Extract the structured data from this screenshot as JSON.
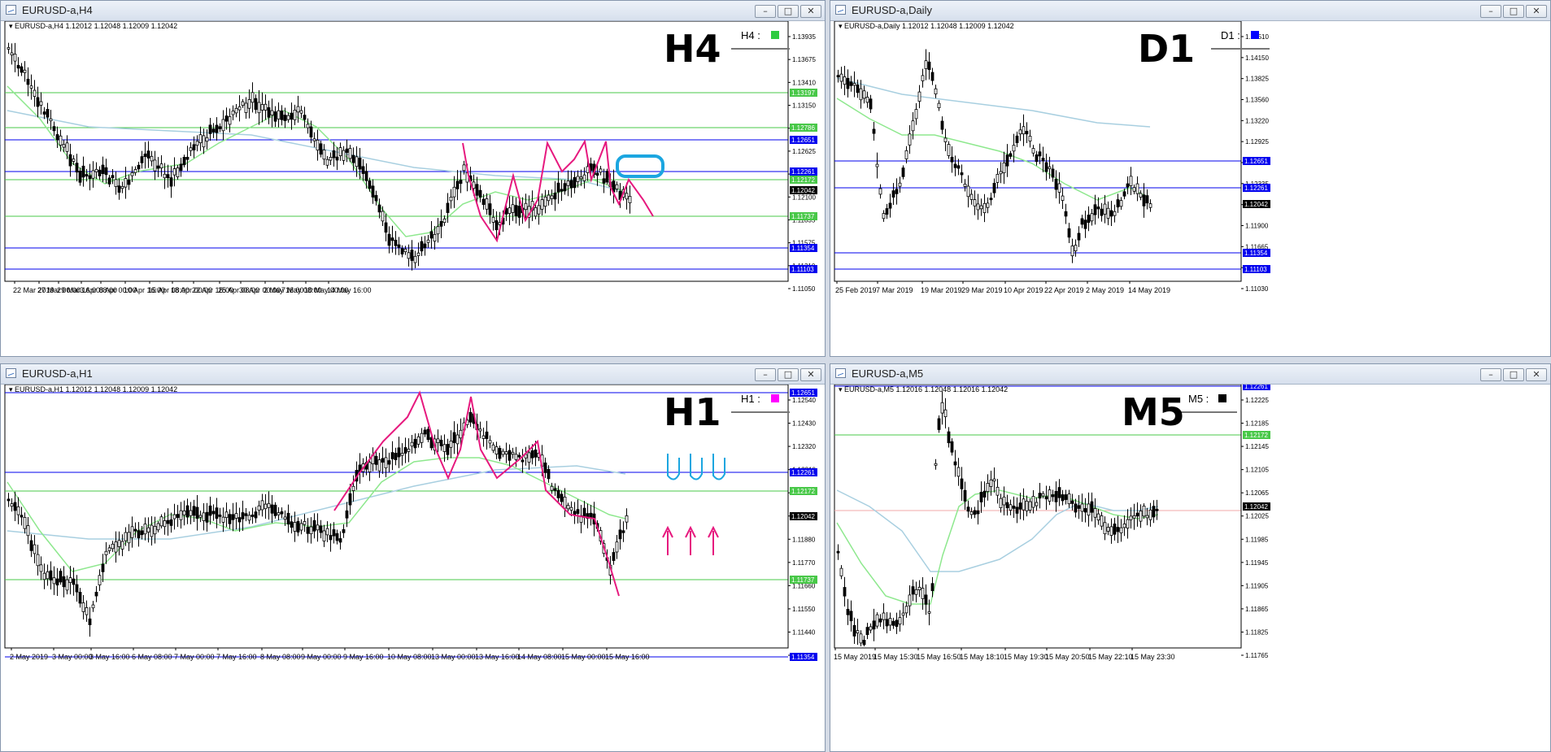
{
  "colors": {
    "green_level": "#48c848",
    "blue_level": "#0000ee",
    "ma_fast": "#8ee88e",
    "ma_slow": "#a8cfe0",
    "ma_red": "#f2a8a8",
    "annotation_pink": "#e6197e",
    "annotation_cyan": "#1ba6e0",
    "bull": "#ffffff",
    "bear": "#000000"
  },
  "windows": [
    {
      "id": "h4",
      "title": "EURUSD-a,H4",
      "buttons": [
        "minimize",
        "restore",
        "close"
      ],
      "header": "EURUSD-a,H4  1.12012 1.12048 1.12009 1.12042",
      "label": "H4 :",
      "label_color": "#2ecc40",
      "handwritten": "H4",
      "price_labels": [
        "1.13935",
        "1.13675",
        "1.13410",
        "1.13150",
        "1.12885",
        "1.12625",
        "1.12360",
        "1.12100",
        "1.11835",
        "1.11575",
        "1.11310",
        "1.11050"
      ],
      "level_tags": [
        {
          "text": "1.13197",
          "color": "green"
        },
        {
          "text": "1.12786",
          "color": "green"
        },
        {
          "text": "1.12651",
          "color": "blue"
        },
        {
          "text": "1.12261",
          "color": "blue"
        },
        {
          "text": "1.12172",
          "color": "green"
        },
        {
          "text": "1.12042",
          "color": "black"
        },
        {
          "text": "1.11737",
          "color": "green"
        },
        {
          "text": "1.11354",
          "color": "blue"
        },
        {
          "text": "1.11103",
          "color": "blue"
        }
      ],
      "time_labels": [
        "22 Mar 2019",
        "27 Mar 00:00",
        "29 Mar 16:00",
        "3 Apr 08:00",
        "8 Apr 00:00",
        "10 Apr 16:00",
        "15 Apr 08:00",
        "18 Apr 00:00",
        "22 Apr 16:00",
        "25 Apr 08:00",
        "30 Apr 00:00",
        "2 May 16:00",
        "7 May 08:00",
        "10 May 00:00",
        "14 May 16:00"
      ]
    },
    {
      "id": "d1",
      "title": "EURUSD-a,Daily",
      "buttons": [
        "minimize",
        "restore",
        "close"
      ],
      "header": "EURUSD-a,Daily  1.12012 1.12048 1.12009 1.12042",
      "label": "D1 :",
      "label_color": "#0000ff",
      "handwritten": "D1",
      "price_labels": [
        "1.14510",
        "1.14150",
        "1.13825",
        "1.13560",
        "1.13220",
        "1.12925",
        "1.12630",
        "1.12335",
        "1.12040",
        "1.11900",
        "1.11665",
        "1.11310",
        "1.11030"
      ],
      "level_tags": [
        {
          "text": "1.12651",
          "color": "blue"
        },
        {
          "text": "1.12261",
          "color": "blue"
        },
        {
          "text": "1.12042",
          "color": "black"
        },
        {
          "text": "1.11354",
          "color": "blue"
        },
        {
          "text": "1.11103",
          "color": "blue"
        }
      ],
      "time_labels": [
        "25 Feb 2019",
        "7 Mar 2019",
        "19 Mar 2019",
        "29 Mar 2019",
        "10 Apr 2019",
        "22 Apr 2019",
        "2 May 2019",
        "14 May 2019"
      ]
    },
    {
      "id": "h1",
      "title": "EURUSD-a,H1",
      "buttons": [
        "minimize",
        "restore",
        "close"
      ],
      "header": "EURUSD-a,H1  1.12012 1.12048 1.12009 1.12042",
      "label": "H1 :",
      "label_color": "#ff00ff",
      "handwritten": "H1",
      "price_labels": [
        "1.12540",
        "1.12430",
        "1.12320",
        "1.12210",
        "1.12100",
        "1.11990",
        "1.11880",
        "1.11770",
        "1.11660",
        "1.11550",
        "1.11440",
        "1.11330"
      ],
      "level_tags": [
        {
          "text": "1.12651",
          "color": "blue"
        },
        {
          "text": "1.12261",
          "color": "blue"
        },
        {
          "text": "1.12172",
          "color": "green"
        },
        {
          "text": "1.12042",
          "color": "black"
        },
        {
          "text": "1.11737",
          "color": "green"
        },
        {
          "text": "1.11354",
          "color": "blue"
        }
      ],
      "time_labels": [
        "2 May 2019",
        "3 May 00:00",
        "3 May 16:00",
        "6 May 08:00",
        "7 May 00:00",
        "7 May 16:00",
        "8 May 08:00",
        "9 May 00:00",
        "9 May 16:00",
        "10 May 08:00",
        "13 May 00:00",
        "13 May 16:00",
        "14 May 08:00",
        "15 May 00:00",
        "15 May 16:00"
      ]
    },
    {
      "id": "m5",
      "title": "EURUSD-a,M5",
      "buttons": [
        "minimize",
        "restore",
        "close"
      ],
      "header": "EURUSD-a,M5  1.12016 1.12048 1.12016 1.12042",
      "label": "M5 :",
      "label_color": "#000000",
      "handwritten": "M5",
      "price_labels": [
        "1.12225",
        "1.12185",
        "1.12145",
        "1.12105",
        "1.12065",
        "1.12025",
        "1.11985",
        "1.11945",
        "1.11905",
        "1.11865",
        "1.11825",
        "1.11765"
      ],
      "level_tags": [
        {
          "text": "1.12261",
          "color": "blue"
        },
        {
          "text": "1.12172",
          "color": "green"
        },
        {
          "text": "1.12042",
          "color": "black"
        }
      ],
      "time_labels": [
        "15 May 2019",
        "15 May 15:30",
        "15 May 16:50",
        "15 May 18:10",
        "15 May 19:30",
        "15 May 20:50",
        "15 May 22:10",
        "15 May 23:30"
      ]
    }
  ]
}
